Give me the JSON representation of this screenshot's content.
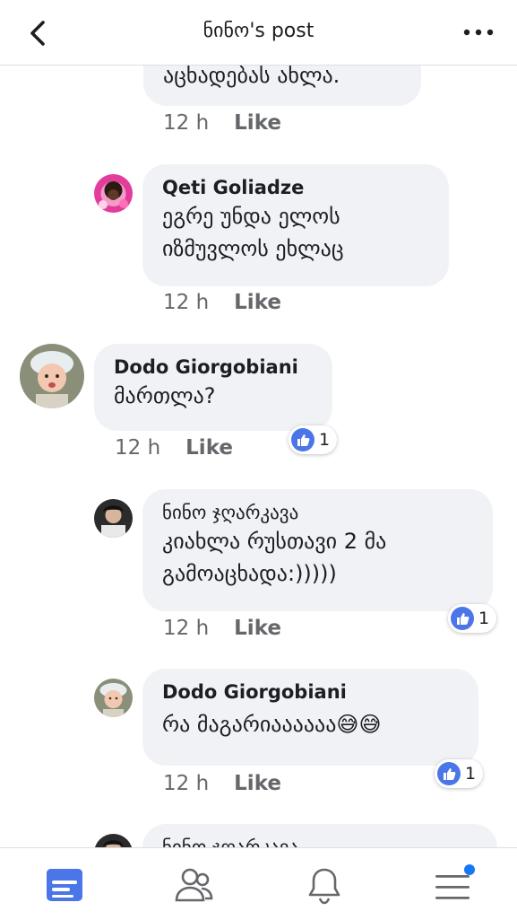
{
  "header": {
    "title": "ნინო's post",
    "back_icon": "chevron-left-icon",
    "more_icon": "ellipsis-icon"
  },
  "comments": [
    {
      "author": "",
      "lines": [
        "აცხადებას ახლა."
      ],
      "time": "12 h",
      "like_label": "Like"
    },
    {
      "author": "Qeti Goliadze",
      "lines": [
        "ეგრე უნდა  ელოს",
        "იზმუვლოს ეხლაც"
      ],
      "time": "12 h",
      "like_label": "Like"
    },
    {
      "author": "Dodo Giorgobiani",
      "lines": [
        "მართლა?"
      ],
      "time": "12 h",
      "like_label": "Like",
      "reaction_count": "1"
    },
    {
      "author": "ნინო ჯღარკავა",
      "lines": [
        "კიახლა რუსთავი 2 მა",
        "გამოაცხადა:)))))"
      ],
      "time": "12 h",
      "like_label": "Like",
      "reaction_count": "1"
    },
    {
      "author": "Dodo Giorgobiani",
      "lines": [
        "რა მაგარიაააააა😅😅"
      ],
      "time": "12 h",
      "like_label": "Like",
      "reaction_count": "1"
    },
    {
      "author": "ნინო ჯღარკავა",
      "lines": [],
      "time": "",
      "like_label": ""
    }
  ],
  "bottom_nav": {
    "items": [
      {
        "icon": "news-feed-icon",
        "active": true
      },
      {
        "icon": "friends-icon",
        "active": false
      },
      {
        "icon": "notifications-bell-icon",
        "active": false
      },
      {
        "icon": "menu-icon",
        "active": false,
        "badge": true
      }
    ]
  },
  "colors": {
    "accent": "#4a76e8",
    "bubble": "#f0f2f5",
    "meta_text": "#65676b",
    "notification_dot": "#1877f2"
  }
}
